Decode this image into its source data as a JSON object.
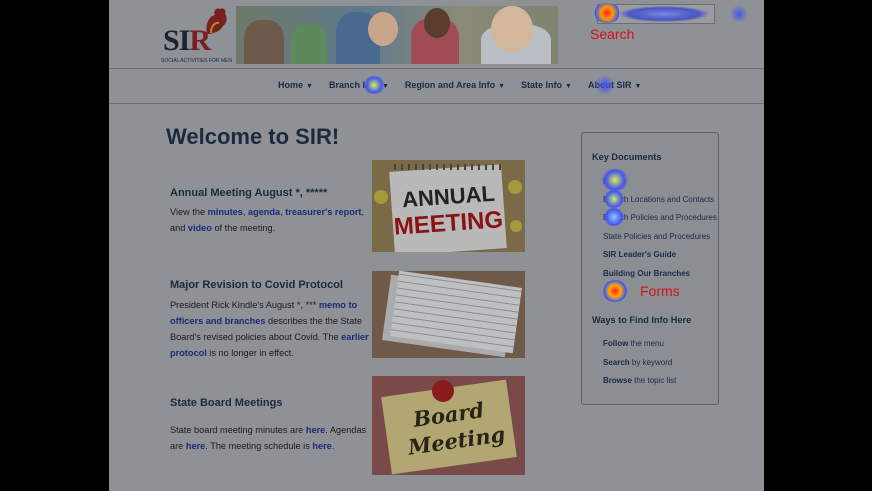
{
  "header": {
    "logo_text_s": "S",
    "logo_text_i": "I",
    "logo_text_r": "R",
    "tagline": "SOCIAL ACTIVITIES FOR MEN",
    "search_label": "Search"
  },
  "nav": {
    "items": [
      {
        "label": "Home"
      },
      {
        "label": "Branch Info"
      },
      {
        "label": "Region and Area Info"
      },
      {
        "label": "State Info"
      },
      {
        "label": "About SIR"
      }
    ]
  },
  "main": {
    "title": "Welcome to SIR!",
    "items": [
      {
        "heading": "Annual Meeting August *, *****",
        "text_1": "View the ",
        "link_1": "minutes",
        "text_2": ", ",
        "link_2": "agenda",
        "text_3": ", ",
        "link_3": "treasurer's report",
        "text_4": ", and ",
        "link_4": "video",
        "text_5": " of the meeting.",
        "image_text_1": "ANNUAL",
        "image_text_2": "MEETING"
      },
      {
        "heading": "Major Revision to Covid Protocol",
        "text_1": "President Rick Kindle's August *, *** ",
        "link_1": "memo to officers and branches",
        "text_2": " describes the the State Board's revised policies about Covid. The ",
        "link_2": "earlier protocol",
        "text_3": " is no longer in effect."
      },
      {
        "heading": "State Board Meetings",
        "text_1": "State board meeting minutes are ",
        "link_1": "here",
        "text_2": ". Agendas are ",
        "link_2": "here",
        "text_3": ". The meeting schedule is ",
        "link_3": "here",
        "text_4": ".",
        "image_text_1": "Board",
        "image_text_2": "Meeting"
      }
    ]
  },
  "sidebar": {
    "heading_1": "Key Documents",
    "links_1": [
      "Forms",
      "Branch Locations and Contacts",
      "Branch Policies and Procedures",
      "State Policies and Procedures",
      "SIR Leader's Guide",
      "Building Our Branches"
    ],
    "forms_label": "Forms",
    "heading_2": "Ways to Find Info Here",
    "links_2": [
      {
        "prefix": "Follow",
        "rest": " the menu"
      },
      {
        "prefix": "Search",
        "rest": " by keyword"
      },
      {
        "prefix": "Browse",
        "rest": " the topic list"
      }
    ]
  },
  "colors": {
    "accent_red": "#d01515",
    "link": "#1c2a7a",
    "heading": "#1d2a3c"
  }
}
